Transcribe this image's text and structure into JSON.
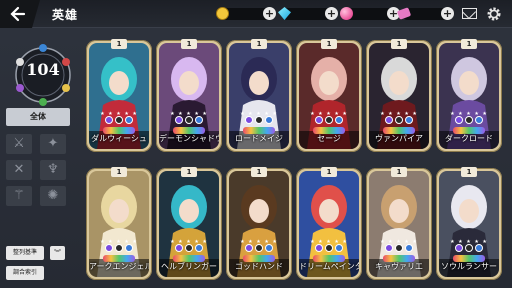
{
  "header": {
    "title": "英雄"
  },
  "resources": [
    {
      "name": "gold",
      "icon": "gold-coin-icon",
      "color": "#f3c73b"
    },
    {
      "name": "gem",
      "icon": "diamond-gem-icon",
      "color": "#38d7ff"
    },
    {
      "name": "orb",
      "icon": "pink-orb-icon",
      "color": "#ff4fa2"
    },
    {
      "name": "ticket",
      "icon": "ticket-icon",
      "color": "#e67ac4"
    }
  ],
  "sidebar": {
    "hero_count": "104",
    "all_label": "全体",
    "sort_label": "整列基準",
    "search_label": "調合索引",
    "sort_direction_icon": "double-chevron-down-icon",
    "class_filters": [
      {
        "icon": "sword-icon",
        "glyph": "⚔"
      },
      {
        "icon": "claw-icon",
        "glyph": "✦"
      },
      {
        "icon": "crossed-blades-icon",
        "glyph": "✕"
      },
      {
        "icon": "bow-icon",
        "glyph": "♆"
      },
      {
        "icon": "staff-icon",
        "glyph": "⚚"
      },
      {
        "icon": "fire-icon",
        "glyph": "✺"
      }
    ]
  },
  "cards": [
    {
      "name": "ダルウィーシュ",
      "level": "1",
      "bg": "#2f6f8f",
      "hair": "#35c0c8",
      "accent": "#c22b3a"
    },
    {
      "name": "デーモンシャドウ",
      "level": "1",
      "bg": "#6b4a7a",
      "hair": "#d8b8f0",
      "accent": "#2a1a32"
    },
    {
      "name": "ロードメイジ",
      "level": "1",
      "bg": "#3a3f6a",
      "hair": "#2b2a55",
      "accent": "#e6e6ee"
    },
    {
      "name": "セージ",
      "level": "1",
      "bg": "#5a2a2a",
      "hair": "#e5b0a8",
      "accent": "#b0252b"
    },
    {
      "name": "ヴァンパイア",
      "level": "1",
      "bg": "#2a2430",
      "hair": "#d9d9d9",
      "accent": "#6e1a1e"
    },
    {
      "name": "ダークロード",
      "level": "1",
      "bg": "#3b3350",
      "hair": "#cfc7e0",
      "accent": "#6b4ba0"
    },
    {
      "name": "アークエンジェル",
      "level": "1",
      "bg": "#a99466",
      "hair": "#e8d7a0",
      "accent": "#f2e8d0"
    },
    {
      "name": "ヘルブリンガー",
      "level": "1",
      "bg": "#1f3340",
      "hair": "#35b8c8",
      "accent": "#d4a33a"
    },
    {
      "name": "ゴッドハンド",
      "level": "1",
      "bg": "#4a3a2a",
      "hair": "#5a3a20",
      "accent": "#d9a040"
    },
    {
      "name": "ドリームペインター",
      "level": "1",
      "bg": "#2f4fa0",
      "hair": "#e0504a",
      "accent": "#f2c040"
    },
    {
      "name": "キャヴァリエ",
      "level": "1",
      "bg": "#8c7c70",
      "hair": "#c8a070",
      "accent": "#f0e8e0"
    },
    {
      "name": "ソウルランサー",
      "level": "1",
      "bg": "#4a5060",
      "hair": "#e8e8f0",
      "accent": "#2a2a3a"
    }
  ]
}
